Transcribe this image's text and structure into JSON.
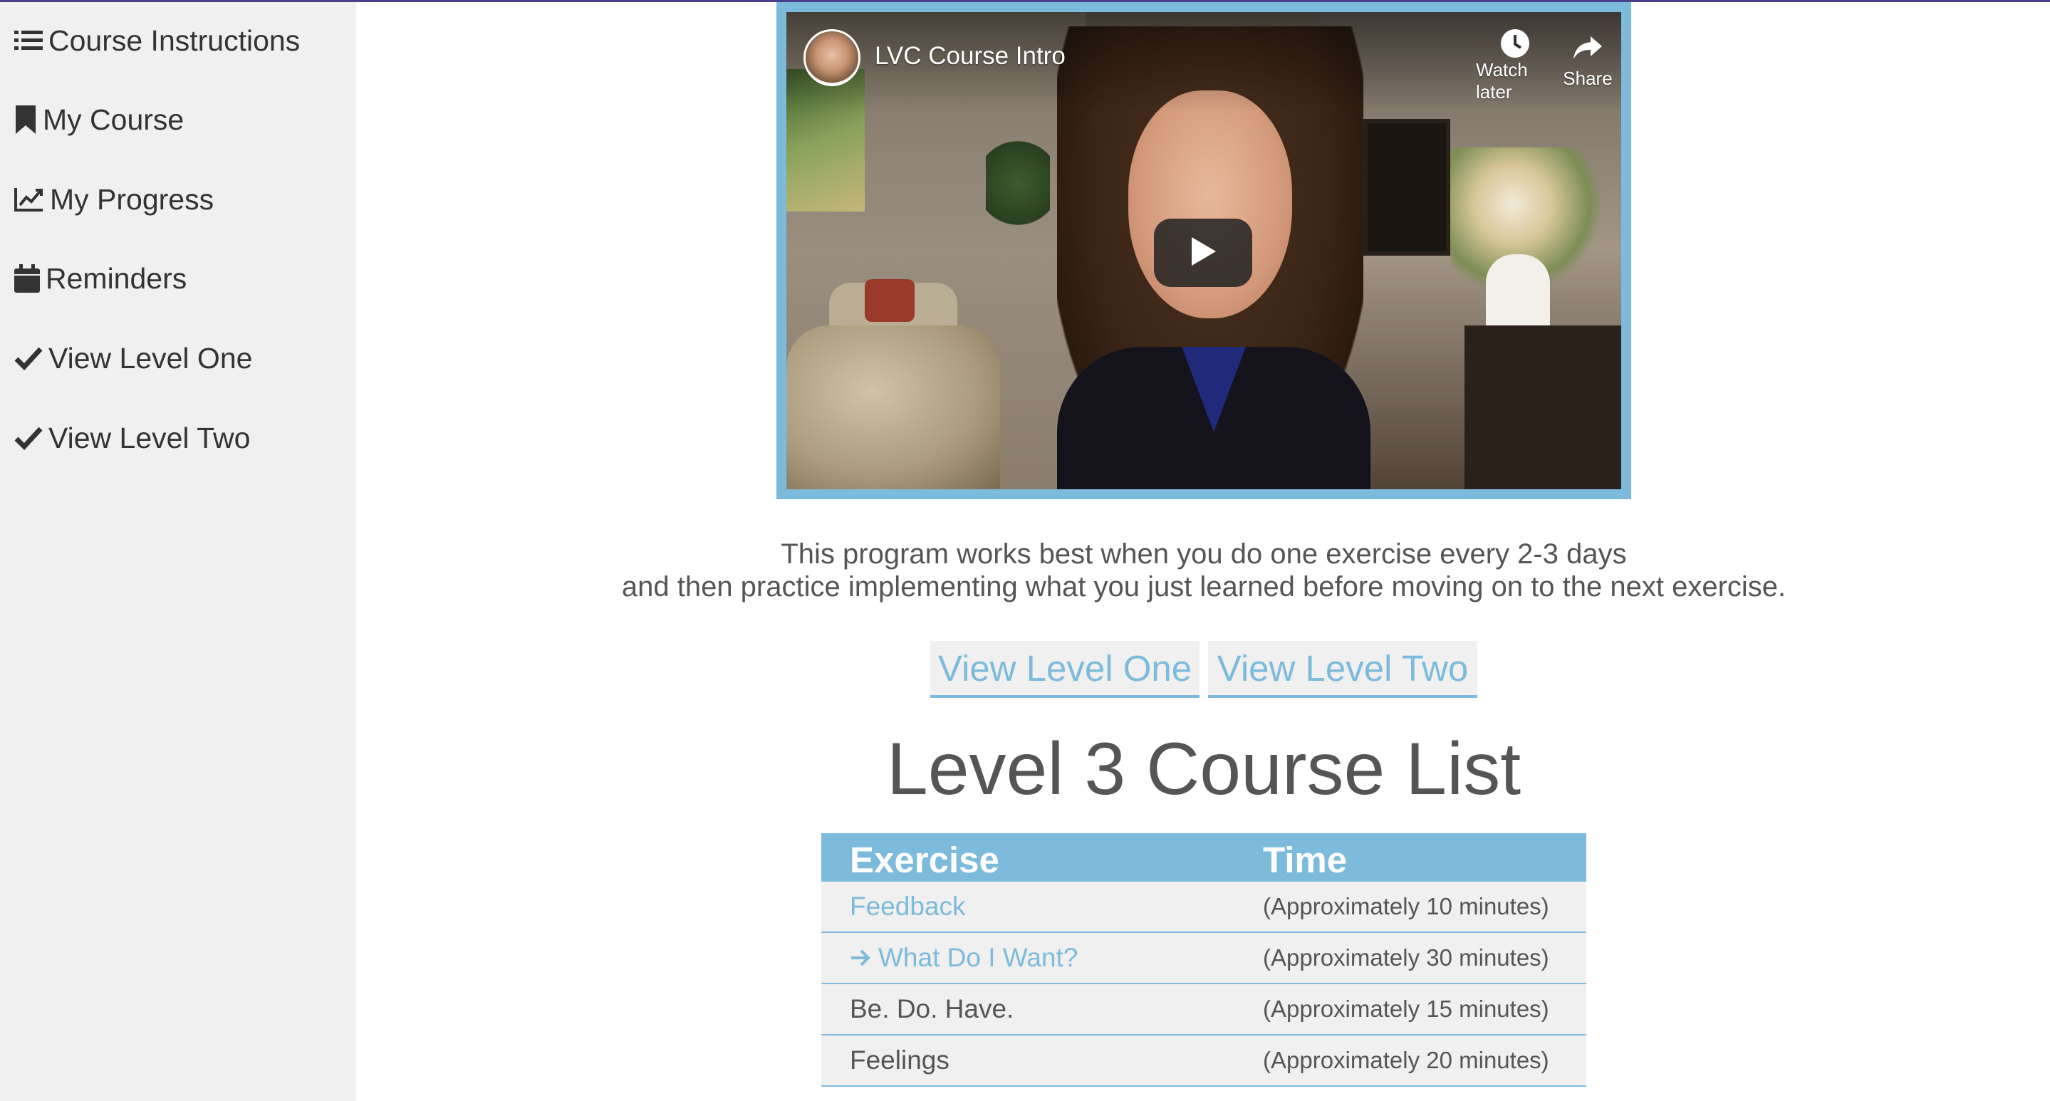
{
  "colors": {
    "accent": "#7dbbdc",
    "sidebar_bg": "#f0f0f0",
    "text": "#555555",
    "top_line": "#4a3f8f"
  },
  "sidebar": {
    "items": [
      {
        "label": "Course Instructions",
        "icon": "list-icon"
      },
      {
        "label": "My Course",
        "icon": "bookmark-icon"
      },
      {
        "label": "My Progress",
        "icon": "line-chart-icon"
      },
      {
        "label": "Reminders",
        "icon": "calendar-icon"
      },
      {
        "label": "View Level One",
        "icon": "check-icon"
      },
      {
        "label": "View Level Two",
        "icon": "check-icon"
      }
    ]
  },
  "video": {
    "title": "LVC Course Intro",
    "watch_later_label": "Watch later",
    "share_label": "Share"
  },
  "intro": {
    "line1": "This program works best when you do one exercise every 2-3 days",
    "line2": "and then practice implementing what you just learned before moving on to the next exercise."
  },
  "level_buttons": {
    "one": "View Level One",
    "two": "View Level Two"
  },
  "course_list": {
    "title": "Level 3 Course List",
    "headers": {
      "exercise": "Exercise",
      "time": "Time"
    },
    "rows": [
      {
        "exercise": "Feedback",
        "time": "(Approximately 10 minutes)",
        "link": true,
        "current": false
      },
      {
        "exercise": "What Do I Want?",
        "time": "(Approximately 30 minutes)",
        "link": true,
        "current": true
      },
      {
        "exercise": "Be. Do. Have.",
        "time": "(Approximately 15 minutes)",
        "link": false,
        "current": false
      },
      {
        "exercise": "Feelings",
        "time": "(Approximately 20 minutes)",
        "link": false,
        "current": false
      }
    ]
  }
}
